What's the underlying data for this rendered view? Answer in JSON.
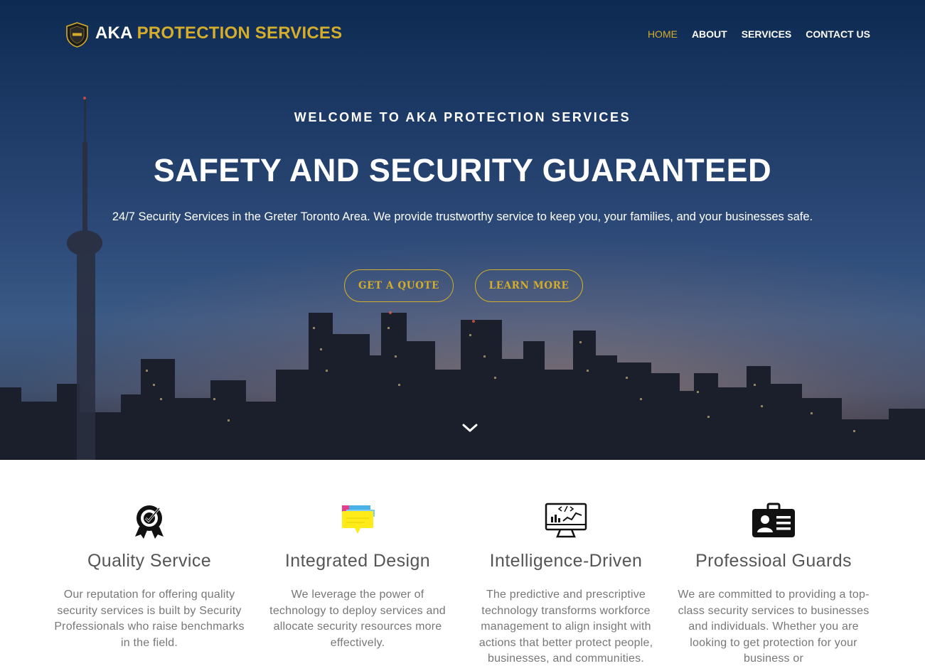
{
  "colors": {
    "accent": "#d3ad2b",
    "hero_bg": "#1d3a66",
    "heading": "#555555",
    "body_text": "#777777"
  },
  "brand": {
    "name_first": "AKA",
    "name_rest": "PROTECTION SERVICES",
    "logo_icon": "shield-badge-icon"
  },
  "nav": {
    "items": [
      {
        "label": "HOME",
        "active": true
      },
      {
        "label": "ABOUT",
        "active": false
      },
      {
        "label": "SERVICES",
        "active": false
      },
      {
        "label": "CONTACT US",
        "active": false
      }
    ]
  },
  "hero": {
    "eyebrow": "WELCOME TO AKA PROTECTION SERVICES",
    "title": "SAFETY AND SECURITY GUARANTEED",
    "subtitle": "24/7 Security Services in the Greter Toronto Area. We provide trustworthy service to keep you, your families, and your businesses safe.",
    "buttons": {
      "quote": "GET A QUOTE",
      "learn": "LEARN MORE"
    },
    "scroll_icon": "chevron-down-icon"
  },
  "features": [
    {
      "icon": "quality-badge-icon",
      "title": "Quality Service",
      "text": "Our reputation for offering quality security services is built by Security Professionals who raise benchmarks in the field."
    },
    {
      "icon": "chat-bubble-icon",
      "title": "Integrated Design",
      "text": "We leverage the power of technology to deploy services and allocate security resources more effectively."
    },
    {
      "icon": "monitor-analytics-icon",
      "title": "Intelligence-Driven",
      "text": "The predictive and prescriptive technology transforms workforce management to align insight with actions that better protect people, businesses, and communities."
    },
    {
      "icon": "id-card-icon",
      "title": "Professioal Guards",
      "text": "We are committed to providing a top-class security services to businesses and individuals. Whether you are looking to get protection for your business or"
    }
  ]
}
